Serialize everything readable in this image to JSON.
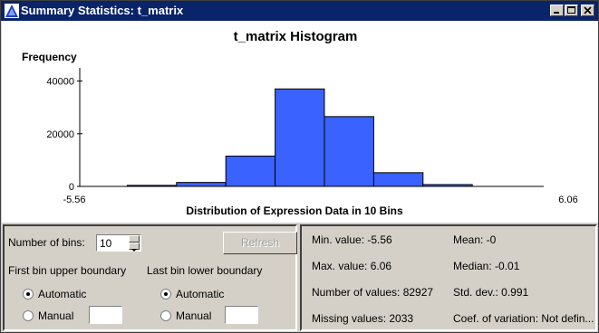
{
  "window": {
    "title": "Summary Statistics: t_matrix",
    "controls": [
      "minimize-icon",
      "maximize-icon",
      "close-icon"
    ],
    "title_bar_color": "#0a246a"
  },
  "chart_data": {
    "type": "bar",
    "title": "t_matrix Histogram",
    "ylabel": "Frequency",
    "xlabel": "Distribution of Expression Data in 10 Bins",
    "x_min_label": "-5.56",
    "x_max_label": "6.06",
    "x_range": [
      -5.56,
      6.06
    ],
    "ylim": [
      0,
      45000
    ],
    "y_ticks": [
      "0",
      "20000",
      "40000"
    ],
    "y_tick_values": [
      0,
      20000,
      40000
    ],
    "bins": 10,
    "values": [
      0,
      400,
      1500,
      11500,
      37000,
      26500,
      5200,
      700,
      0,
      0
    ],
    "bar_color": "#3a62ff",
    "grid": false
  },
  "controls": {
    "bins_label": "Number of bins:",
    "bins_value": "10",
    "refresh_label": "Refresh",
    "first_boundary_label": "First bin upper boundary",
    "last_boundary_label": "Last bin lower boundary",
    "automatic_label": "Automatic",
    "manual_label": "Manual",
    "first_selected": "Automatic",
    "last_selected": "Automatic"
  },
  "stats": {
    "min": "Min. value: -5.56",
    "max": "Max. value: 6.06",
    "count": "Number of values: 82927",
    "missing": "Missing values: 2033",
    "mean": "Mean: -0",
    "median": "Median: -0.01",
    "std": "Std. dev.: 0.991",
    "cv": "Coef. of variation: Not defin..."
  }
}
